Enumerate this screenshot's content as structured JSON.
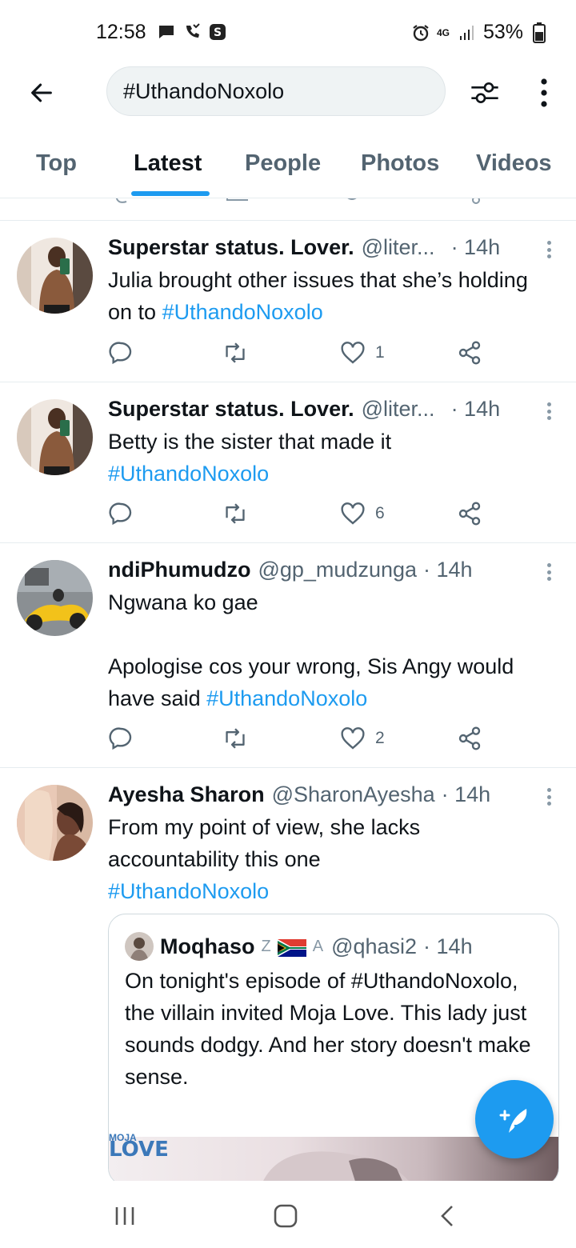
{
  "status_bar": {
    "time": "12:58",
    "battery": "53%",
    "network": "4G",
    "icons": [
      "chat-icon",
      "missed-call-icon",
      "s-app-icon",
      "alarm-icon",
      "signal-icon",
      "battery-icon"
    ]
  },
  "search": {
    "query": "#UthandoNoxolo"
  },
  "tabs": [
    {
      "label": "Top"
    },
    {
      "label": "Latest",
      "active": true
    },
    {
      "label": "People"
    },
    {
      "label": "Photos"
    },
    {
      "label": "Videos"
    }
  ],
  "tweets": [
    {
      "name": "Superstar status. Lover.",
      "handle": "@liter...",
      "time": "· 14h",
      "text": "Julia brought other issues that she’s holding on to ",
      "hashtag": "#UthandoNoxolo",
      "likes": "1"
    },
    {
      "name": "Superstar status. Lover.",
      "handle": "@liter...",
      "time": "· 14h",
      "text": "Betty is the sister that made it",
      "hashtag": "#UthandoNoxolo",
      "likes": "6"
    },
    {
      "name": "ndiPhumudzo",
      "handle": "@gp_mudzunga",
      "time": "· 14h",
      "line1": "Ngwana ko gae",
      "line2": "Apologise cos your wrong, Sis Angy would have said ",
      "hashtag": "#UthandoNoxolo",
      "likes": "2"
    },
    {
      "name": "Ayesha Sharon",
      "handle": "@SharonAyesha",
      "time": "· 14h",
      "text": "From my point of view, she lacks accountability this one",
      "hashtag": "#UthandoNoxolo",
      "quote": {
        "name": "Moqhaso",
        "badge1": "Z",
        "badge2": "A",
        "handle": "@qhasi2",
        "time": "· 14h",
        "text": "On tonight's episode of #UthandoNoxolo, the villain invited Moja Love. This lady just sounds dodgy. And her story doesn't make sense.",
        "media_brand_top": "MOJA",
        "media_brand": "LOVE"
      }
    }
  ],
  "colors": {
    "accent": "#1d9bf0",
    "text": "#0f1419",
    "secondary": "#536471"
  }
}
